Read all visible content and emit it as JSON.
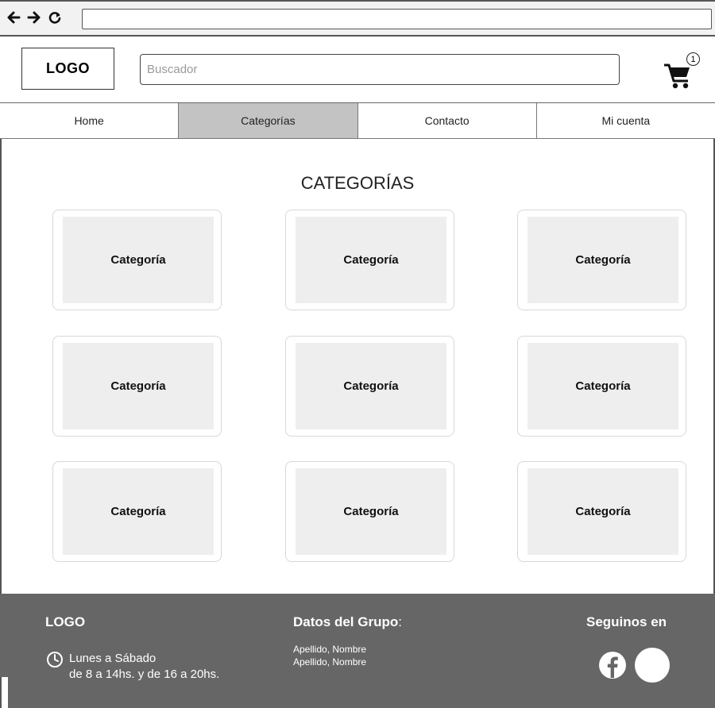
{
  "header": {
    "logo": "LOGO",
    "search_placeholder": "Buscador",
    "cart_count": "1"
  },
  "nav": {
    "items": [
      {
        "label": "Home"
      },
      {
        "label": "Categorías"
      },
      {
        "label": "Contacto"
      },
      {
        "label": "Mi cuenta"
      }
    ],
    "active": "Categorías"
  },
  "main": {
    "title": "CATEGORÍAS",
    "categories": [
      {
        "label": "Categoría"
      },
      {
        "label": "Categoría"
      },
      {
        "label": "Categoría"
      },
      {
        "label": "Categoría"
      },
      {
        "label": "Categoría"
      },
      {
        "label": "Categoría"
      },
      {
        "label": "Categoría"
      },
      {
        "label": "Categoría"
      },
      {
        "label": "Categoría"
      }
    ]
  },
  "footer": {
    "logo": "LOGO",
    "hours_line1": "Lunes a Sábado",
    "hours_line2": "de 8 a 14hs. y de 16 a 20hs.",
    "group_title": "Datos del Grupo",
    "group_colon": ":",
    "members": [
      "Apellido, Nombre",
      "Apellido, Nombre"
    ],
    "follow_title": "Seguinos en",
    "social_icons": [
      "facebook-icon",
      "social-circle-icon"
    ]
  },
  "colors": {
    "footer_bg": "#666666",
    "active_tab": "#c3c3c3",
    "card_fill": "#eeeeee"
  }
}
